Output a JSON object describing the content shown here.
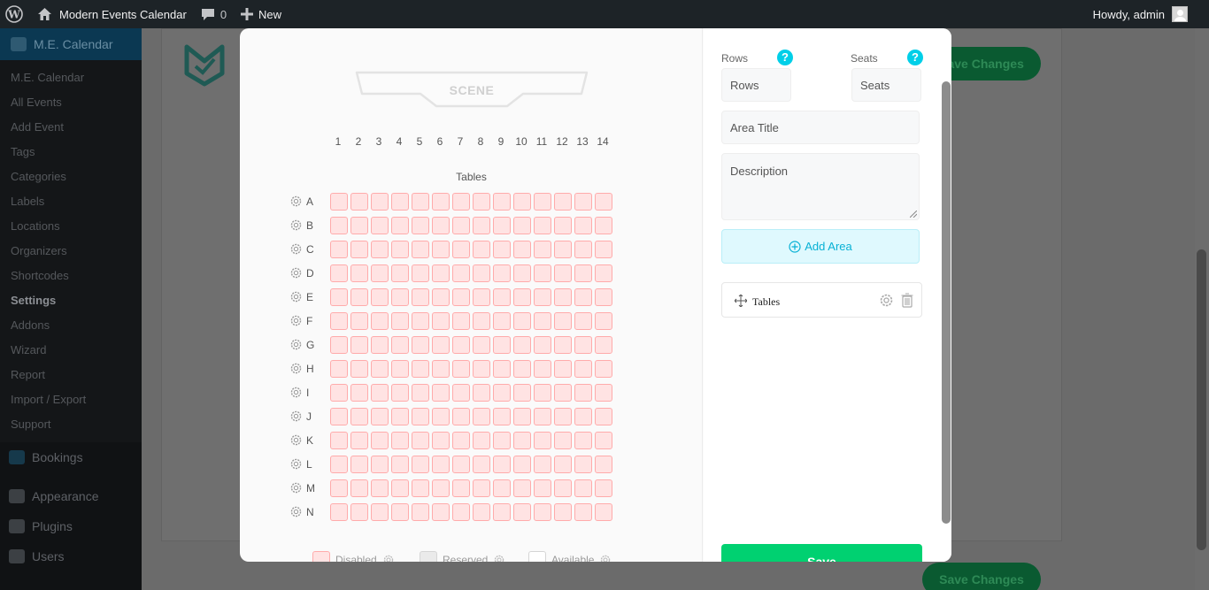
{
  "adminbar": {
    "site_name": "Modern Events Calendar",
    "comments_count": "0",
    "new_label": "New",
    "greeting": "Howdy, admin"
  },
  "sidebar": {
    "top_item": "M.E. Calendar",
    "submenu": [
      "M.E. Calendar",
      "All Events",
      "Add Event",
      "Tags",
      "Categories",
      "Labels",
      "Locations",
      "Organizers",
      "Shortcodes",
      "Settings",
      "Addons",
      "Wizard",
      "Report",
      "Import / Export",
      "Support"
    ],
    "current": "Settings",
    "items": [
      "Bookings",
      "Appearance",
      "Plugins",
      "Users"
    ]
  },
  "background": {
    "save_label": "Save Changes"
  },
  "seat_map": {
    "scene_label": "SCENE",
    "columns": [
      "1",
      "2",
      "3",
      "4",
      "5",
      "6",
      "7",
      "8",
      "9",
      "10",
      "11",
      "12",
      "13",
      "14"
    ],
    "area_title": "Tables",
    "rows": [
      "A",
      "B",
      "C",
      "D",
      "E",
      "F",
      "G",
      "H",
      "I",
      "J",
      "K",
      "L",
      "M",
      "N"
    ],
    "seat_status": "disabled",
    "colors": {
      "disabled_fill": "#ffe3e3",
      "disabled_border": "#ffabab"
    }
  },
  "legend": {
    "disabled": "Disabled",
    "reserved": "Reserved",
    "available": "Available"
  },
  "form": {
    "rows_label": "Rows",
    "seats_label": "Seats",
    "help_glyph": "?",
    "rows_placeholder": "Rows",
    "seats_placeholder": "Seats",
    "area_title_placeholder": "Area Title",
    "description_placeholder": "Description",
    "add_area_label": "Add Area",
    "areas": [
      {
        "label": "Tables"
      }
    ],
    "save_label": "Save"
  },
  "colors": {
    "accent": "#00cfe8",
    "save": "#00d171"
  }
}
